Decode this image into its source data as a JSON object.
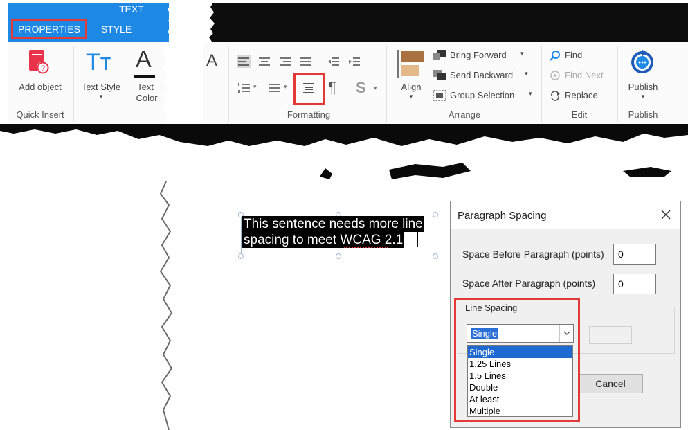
{
  "ribbon": {
    "context_tab": "TEXT",
    "tabs": [
      {
        "label": "PROPERTIES"
      },
      {
        "label": "STYLE"
      }
    ],
    "quick_insert": {
      "add_object": "Add object",
      "group": "Quick Insert"
    },
    "text_style": {
      "label": "Text Style",
      "text_color_line1": "Text",
      "text_color_line2": "Color",
      "icon_glyph": "Tт",
      "a_glyph": "A"
    },
    "font_glyph": "A",
    "formatting": {
      "group": "Formatting",
      "strike_glyph": "S",
      "para_glyph": "¶"
    },
    "arrange": {
      "align": "Align",
      "bring_forward": "Bring Forward",
      "send_backward": "Send Backward",
      "group_selection": "Group Selection",
      "group": "Arrange"
    },
    "edit": {
      "find": "Find",
      "find_next": "Find Next",
      "replace": "Replace",
      "group": "Edit"
    },
    "publish": {
      "label": "Publish",
      "group": "Publish"
    }
  },
  "canvas": {
    "line1": "This sentence needs more line",
    "line2": "spacing to meet WCAG 2.1"
  },
  "dialog": {
    "title": "Paragraph Spacing",
    "space_before_label": "Space Before Paragraph (points)",
    "space_before_value": "0",
    "space_after_label": "Space After Paragraph (points)",
    "space_after_value": "0",
    "line_spacing_label": "Line Spacing",
    "line_spacing_selected": "Single",
    "line_spacing_options": [
      "Single",
      "1.25 Lines",
      "1.5 Lines",
      "Double",
      "At least",
      "Multiple"
    ],
    "cancel_label": "Cancel"
  },
  "colors": {
    "accent_blue": "#1e88e5",
    "highlight_red": "#e53935",
    "add_object_icon": "#e8334a"
  }
}
